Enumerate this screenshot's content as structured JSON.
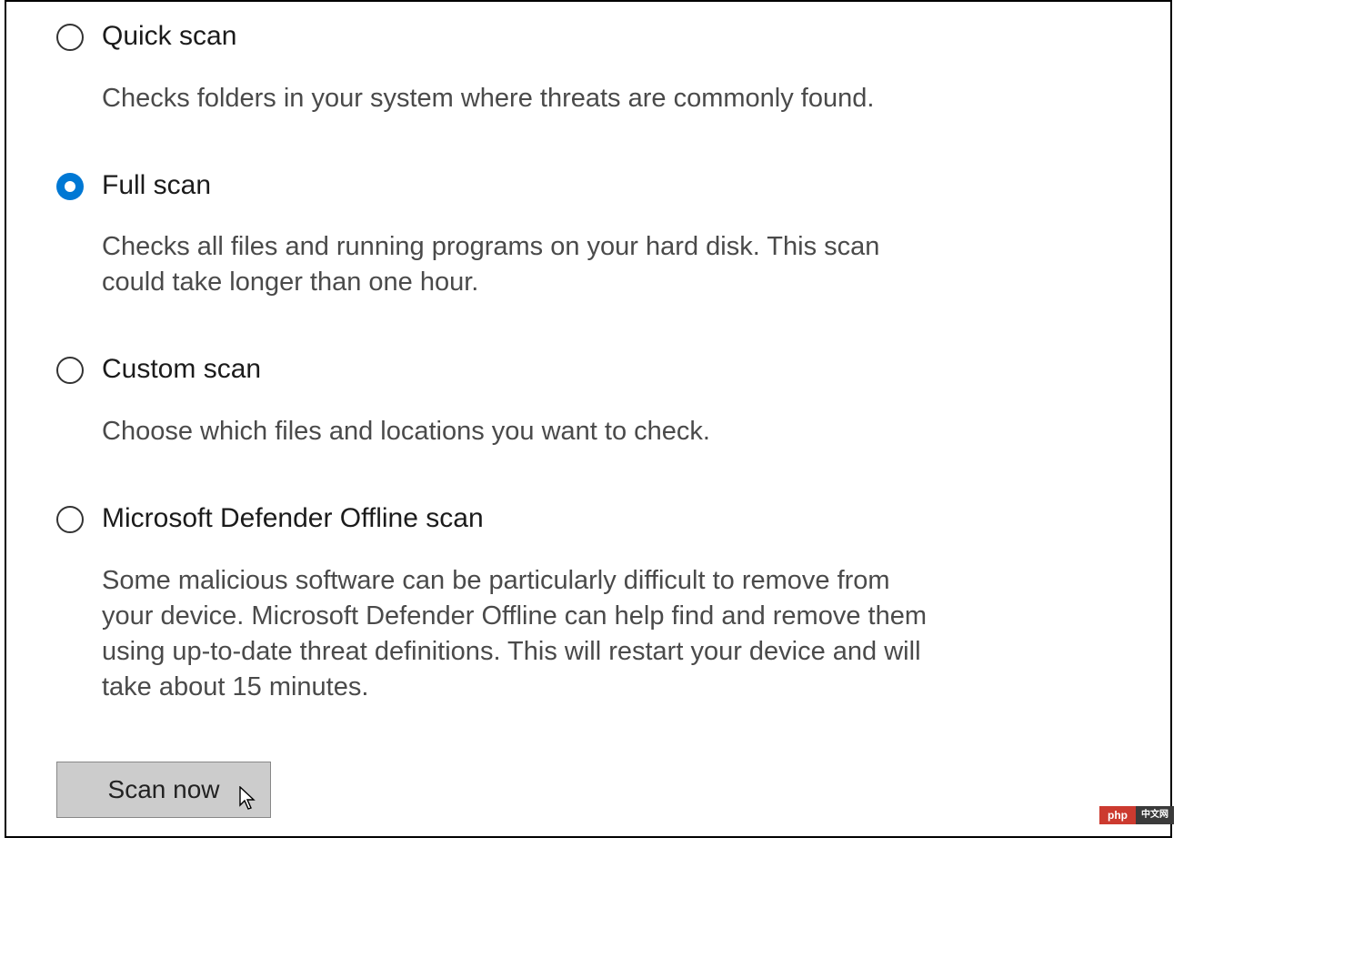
{
  "options": {
    "quick": {
      "title": "Quick scan",
      "desc": "Checks folders in your system where threats are commonly found.",
      "selected": false
    },
    "full": {
      "title": "Full scan",
      "desc": "Checks all files and running programs on your hard disk. This scan could take longer than one hour.",
      "selected": true
    },
    "custom": {
      "title": "Custom scan",
      "desc": "Choose which files and locations you want to check.",
      "selected": false
    },
    "offline": {
      "title": "Microsoft Defender Offline scan",
      "desc": "Some malicious software can be particularly difficult to remove from your device. Microsoft Defender Offline can help find and remove them using up-to-date threat definitions. This will restart your device and will take about 15 minutes.",
      "selected": false
    }
  },
  "button": {
    "scan_now": "Scan now"
  },
  "badge": {
    "left": "php",
    "right": "中文网"
  }
}
